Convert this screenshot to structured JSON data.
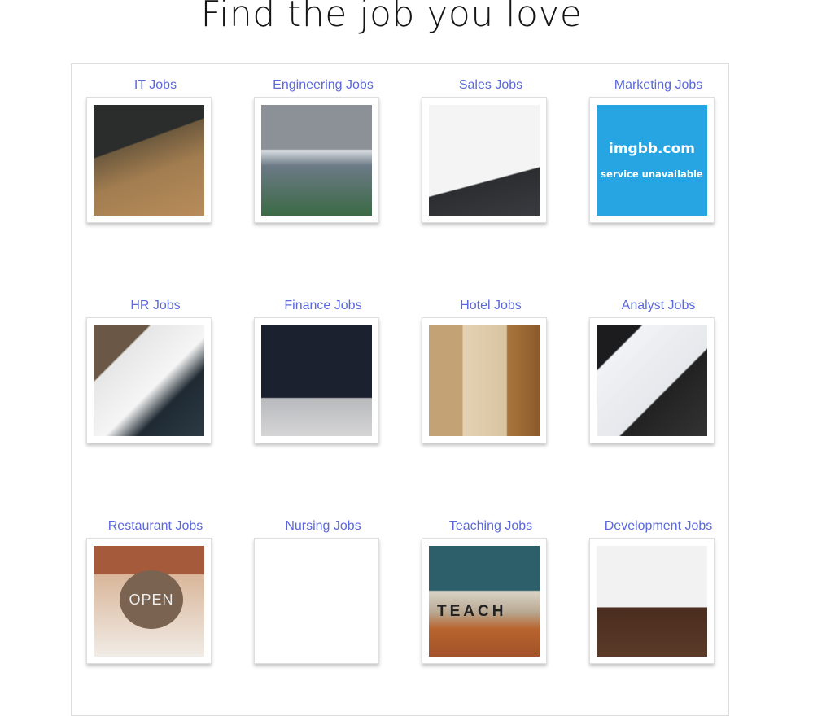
{
  "page": {
    "title": "Find the job you love"
  },
  "categories": [
    {
      "label": "IT Jobs",
      "image": "it"
    },
    {
      "label": "Engineering Jobs",
      "image": "engineering"
    },
    {
      "label": "Sales Jobs",
      "image": "sales"
    },
    {
      "label": "Marketing Jobs",
      "image": "marketing",
      "placeholder_title": "imgbb.com",
      "placeholder_sub": "service unavailable"
    },
    {
      "label": "HR Jobs",
      "image": "hr"
    },
    {
      "label": "Finance Jobs",
      "image": "finance"
    },
    {
      "label": "Hotel Jobs",
      "image": "hotel"
    },
    {
      "label": "Analyst Jobs",
      "image": "analyst"
    },
    {
      "label": "Restaurant Jobs",
      "image": "restaurant",
      "sign_text": "OPEN"
    },
    {
      "label": "Nursing Jobs",
      "image": "nursing"
    },
    {
      "label": "Teaching Jobs",
      "image": "teaching",
      "sign_text": "TEACH"
    },
    {
      "label": "Development Jobs",
      "image": "development"
    }
  ],
  "colors": {
    "label": "#5a68dc",
    "title": "#151515",
    "marketing_bg": "#27a5e2"
  }
}
